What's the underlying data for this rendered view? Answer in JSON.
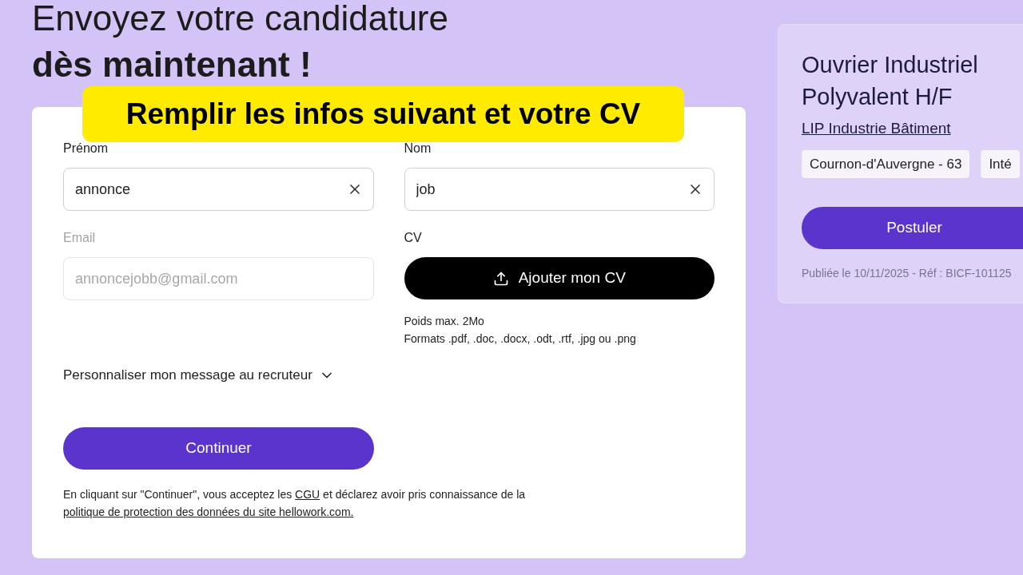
{
  "heading": {
    "line1": "Envoyez votre candidature",
    "line2": "dès maintenant !"
  },
  "banner": "Remplir les infos suivant et votre CV",
  "form": {
    "fields": [
      {
        "label": "Prénom",
        "value": "annonce",
        "disabled": false,
        "clearable": true
      },
      {
        "label": "Nom",
        "value": "job",
        "disabled": false,
        "clearable": true
      },
      {
        "label": "Email",
        "value": "annoncejobb@gmail.com",
        "disabled": true,
        "clearable": false
      }
    ],
    "cv": {
      "label": "CV",
      "button": "Ajouter mon CV",
      "notes": [
        "Poids max. 2Mo",
        "Formats .pdf, .doc, .docx, .odt, .rtf, .jpg ou .png"
      ]
    },
    "message_toggle": {
      "label": "Personnaliser mon message au recruteur",
      "expanded": false
    },
    "submit": "Continuer",
    "consent": [
      {
        "kind": "text",
        "text": "En cliquant sur \"Continuer\", vous acceptez les "
      },
      {
        "kind": "link",
        "text": "CGU"
      },
      {
        "kind": "text",
        "text": " et déclarez avoir pris connaissance de la "
      },
      {
        "kind": "link",
        "text": "politique de protection des données du site hellowork.com."
      }
    ]
  },
  "job": {
    "title": "Ouvrier Industriel Polyvalent H/F",
    "company": "LIP Industrie Bâtiment",
    "tags": [
      "Cournon-d'Auvergne - 63",
      "Inté"
    ],
    "button": "Postuler",
    "meta": "Publiée le 10/11/2025 - Réf : BICF-101125"
  }
}
